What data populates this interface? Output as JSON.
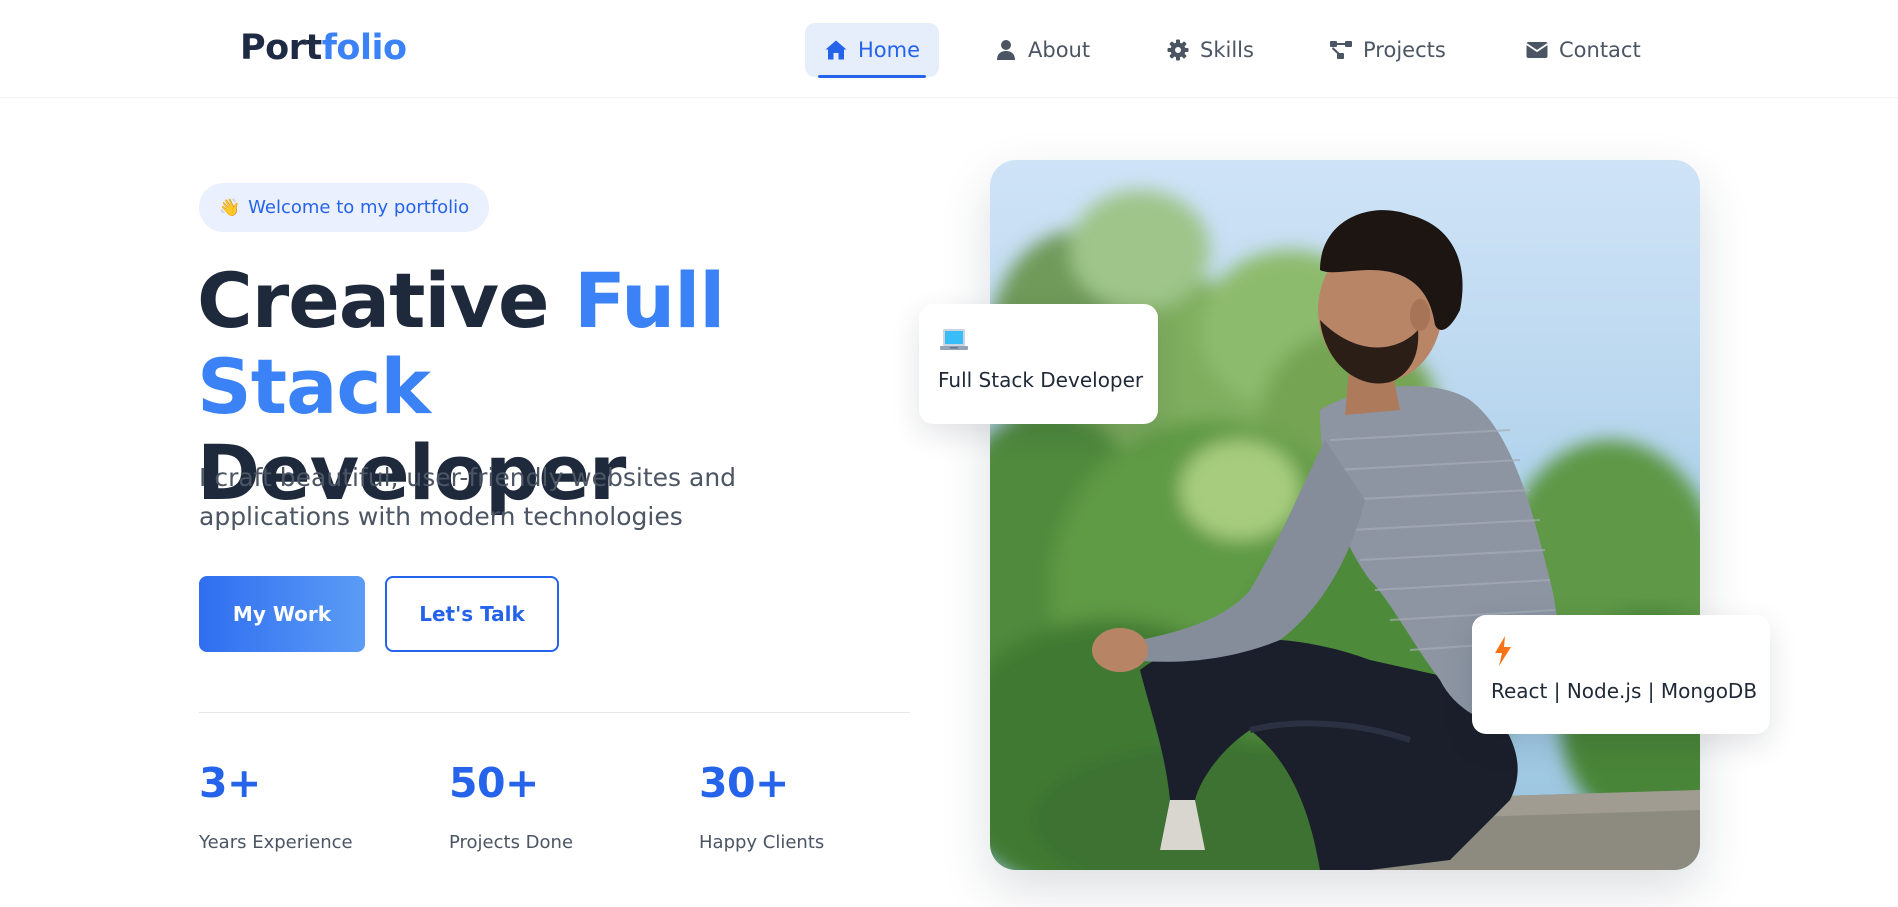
{
  "nav": {
    "logo_part1": "Port",
    "logo_part2": "folio",
    "items": [
      {
        "label": "Home",
        "icon": "home-icon",
        "active": true
      },
      {
        "label": "About",
        "icon": "user-icon",
        "active": false
      },
      {
        "label": "Skills",
        "icon": "gear-icon",
        "active": false
      },
      {
        "label": "Projects",
        "icon": "project-diagram-icon",
        "active": false
      },
      {
        "label": "Contact",
        "icon": "envelope-icon",
        "active": false
      }
    ]
  },
  "hero": {
    "badge_emoji": "👋",
    "badge_text": "Welcome to my portfolio",
    "headline_part1": "Creative ",
    "headline_highlight": "Full Stack",
    "headline_part2": "Developer",
    "subtext": "I craft beautiful, user-friendly websites and applications with modern technologies",
    "primary_button": "My Work",
    "secondary_button": "Let's Talk",
    "stats": [
      {
        "value": "3+",
        "label": "Years Experience"
      },
      {
        "value": "50+",
        "label": "Projects Done"
      },
      {
        "value": "30+",
        "label": "Happy Clients"
      }
    ]
  },
  "profile": {
    "card_role_icon": "laptop-icon",
    "card_role_text": "Full Stack Developer",
    "card_stack_icon": "lightning-icon",
    "card_stack_text": "React | Node.js | MongoDB"
  },
  "colors": {
    "primary": "#2563eb",
    "accent": "#3b82f6",
    "heading": "#1e293b",
    "body_text": "#4b5563",
    "lightning": "#f97316"
  }
}
